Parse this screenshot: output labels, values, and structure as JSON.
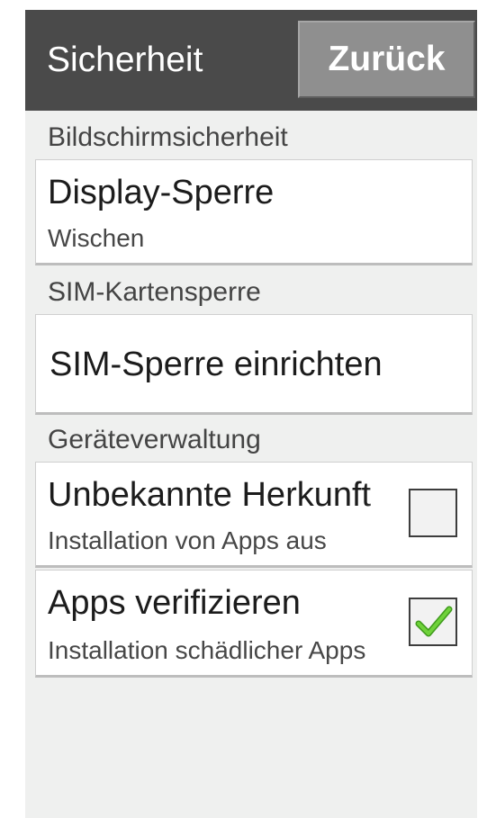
{
  "header": {
    "title": "Sicherheit",
    "back_label": "Zurück"
  },
  "sections": [
    {
      "label": "Bildschirmsicherheit",
      "items": [
        {
          "title": "Display-Sperre",
          "summary": "Wischen"
        }
      ]
    },
    {
      "label": "SIM-Kartensperre",
      "items": [
        {
          "title": "SIM-Sperre einrichten"
        }
      ]
    },
    {
      "label": "Geräteverwaltung",
      "items": [
        {
          "title": "Unbekannte Herkunft",
          "summary": "Installation von Apps aus",
          "checked": false,
          "checkbox_icon": "checkbox-unchecked-icon"
        },
        {
          "title": "Apps verifizieren",
          "summary": "Installation schädlicher Apps",
          "checked": true,
          "checkbox_icon": "checkmark-icon"
        }
      ]
    }
  ],
  "colors": {
    "topbar": "#4a4a4a",
    "back_button": "#8f8f8f",
    "background": "#eff0ef",
    "checkmark": "#5cc42b"
  }
}
